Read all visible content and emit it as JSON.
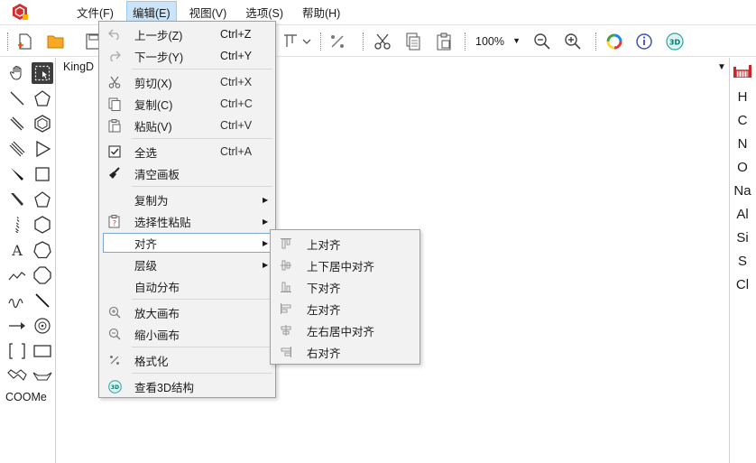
{
  "menubar": {
    "items": [
      {
        "label": "文件(F)"
      },
      {
        "label": "编辑(E)"
      },
      {
        "label": "视图(V)"
      },
      {
        "label": "选项(S)"
      },
      {
        "label": "帮助(H)"
      }
    ]
  },
  "toolbar": {
    "zoom_value": "100%"
  },
  "canvas": {
    "tab_label": "KingD"
  },
  "palette": {
    "coome_label": "COOMe"
  },
  "elements": [
    "H",
    "C",
    "N",
    "O",
    "Na",
    "Al",
    "Si",
    "S",
    "Cl"
  ],
  "edit_menu": {
    "undo": {
      "label": "上一步(Z)",
      "shortcut": "Ctrl+Z"
    },
    "redo": {
      "label": "下一步(Y)",
      "shortcut": "Ctrl+Y"
    },
    "cut": {
      "label": "剪切(X)",
      "shortcut": "Ctrl+X"
    },
    "copy": {
      "label": "复制(C)",
      "shortcut": "Ctrl+C"
    },
    "paste": {
      "label": "粘贴(V)",
      "shortcut": "Ctrl+V"
    },
    "select_all": {
      "label": "全选",
      "shortcut": "Ctrl+A"
    },
    "clear": {
      "label": "清空画板"
    },
    "copy_as": {
      "label": "复制为"
    },
    "paste_special": {
      "label": "选择性粘贴"
    },
    "align": {
      "label": "对齐"
    },
    "layer": {
      "label": "层级"
    },
    "distribute": {
      "label": "自动分布"
    },
    "zoom_in": {
      "label": "放大画布"
    },
    "zoom_out": {
      "label": "缩小画布"
    },
    "format": {
      "label": "格式化"
    },
    "view_3d": {
      "label": "查看3D结构"
    }
  },
  "align_submenu": {
    "top": "上对齐",
    "middle_v": "上下居中对齐",
    "bottom": "下对齐",
    "left": "左对齐",
    "center_h": "左右居中对齐",
    "right": "右对齐"
  },
  "colors": {
    "menu_active_bg": "#cce4f7",
    "menu_bg": "#f2f2f2",
    "highlight_border": "#7aa7d6",
    "logo_red": "#d32f2f",
    "periodic_red": "#c62828",
    "info_blue": "#3f51b5",
    "badge_teal": "#26a69a"
  }
}
